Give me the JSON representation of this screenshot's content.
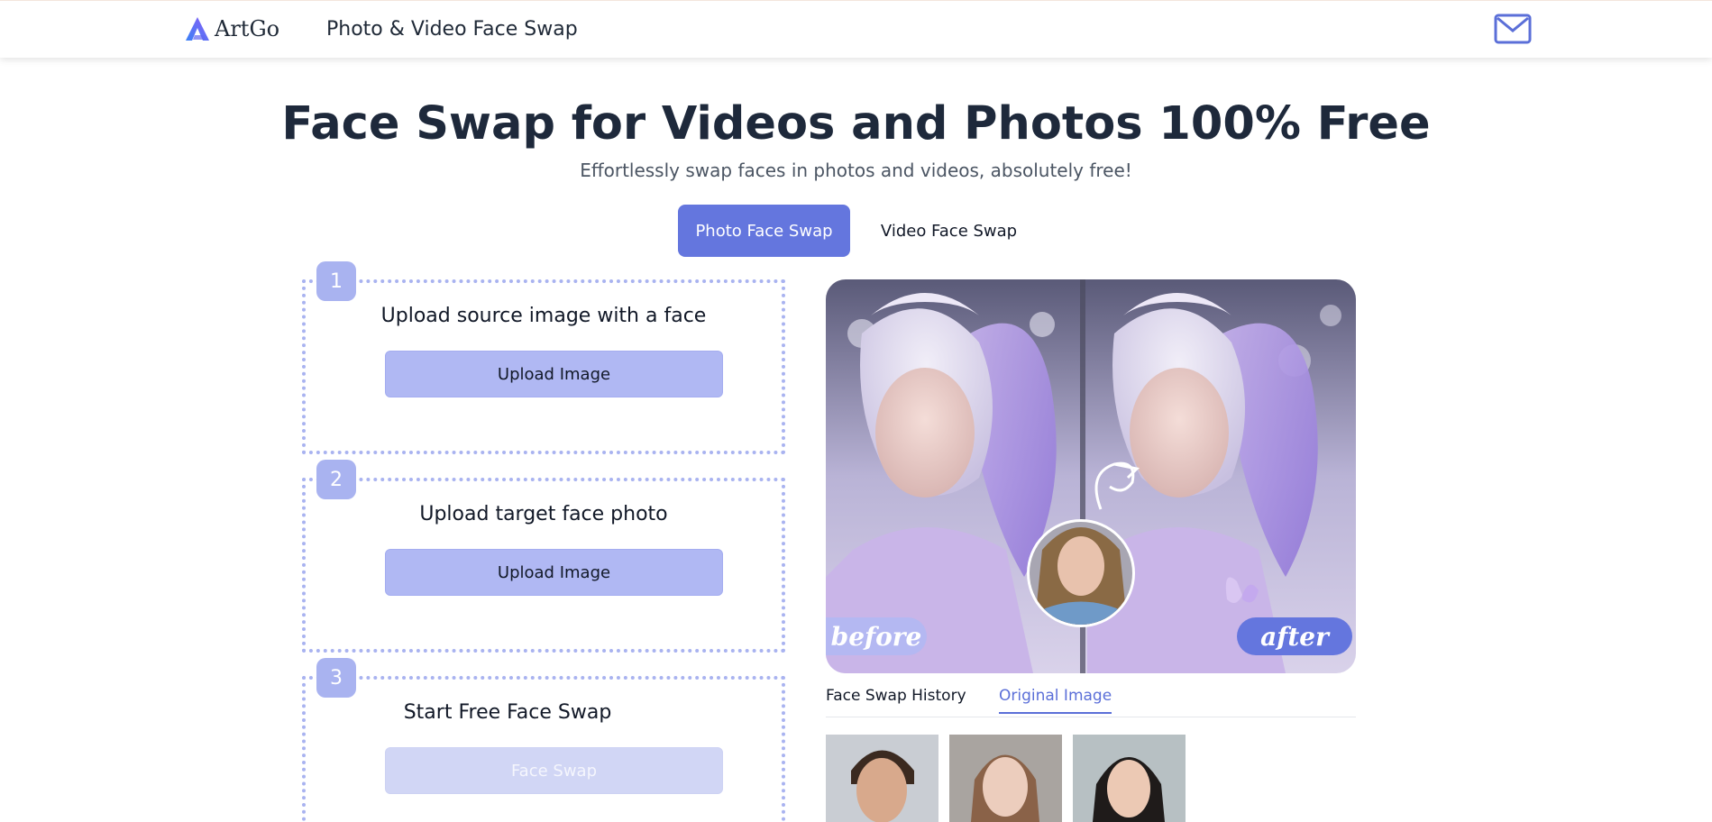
{
  "header": {
    "brand": "ArtGo",
    "nav_title": "Photo & Video Face Swap"
  },
  "hero": {
    "title": "Face Swap for Videos and Photos 100% Free",
    "subtitle": "Effortlessly swap faces in photos and videos, absolutely free!"
  },
  "mode_tabs": [
    {
      "label": "Photo Face Swap",
      "active": true
    },
    {
      "label": "Video Face Swap",
      "active": false
    }
  ],
  "steps": [
    {
      "number": "1",
      "title": "Upload source image with a face",
      "button": "Upload Image"
    },
    {
      "number": "2",
      "title": "Upload target face photo",
      "button": "Upload Image"
    },
    {
      "number": "3",
      "title": "Start Free Face Swap",
      "button": "Face Swap"
    }
  ],
  "preview": {
    "before_label": "before",
    "after_label": "after"
  },
  "history_tabs": [
    {
      "label": "Face Swap History",
      "active": false
    },
    {
      "label": "Original Image",
      "active": true
    }
  ],
  "colors": {
    "accent": "#6476de",
    "accent_light": "#b0b8f3",
    "dotted_border": "#a9b3f0"
  }
}
